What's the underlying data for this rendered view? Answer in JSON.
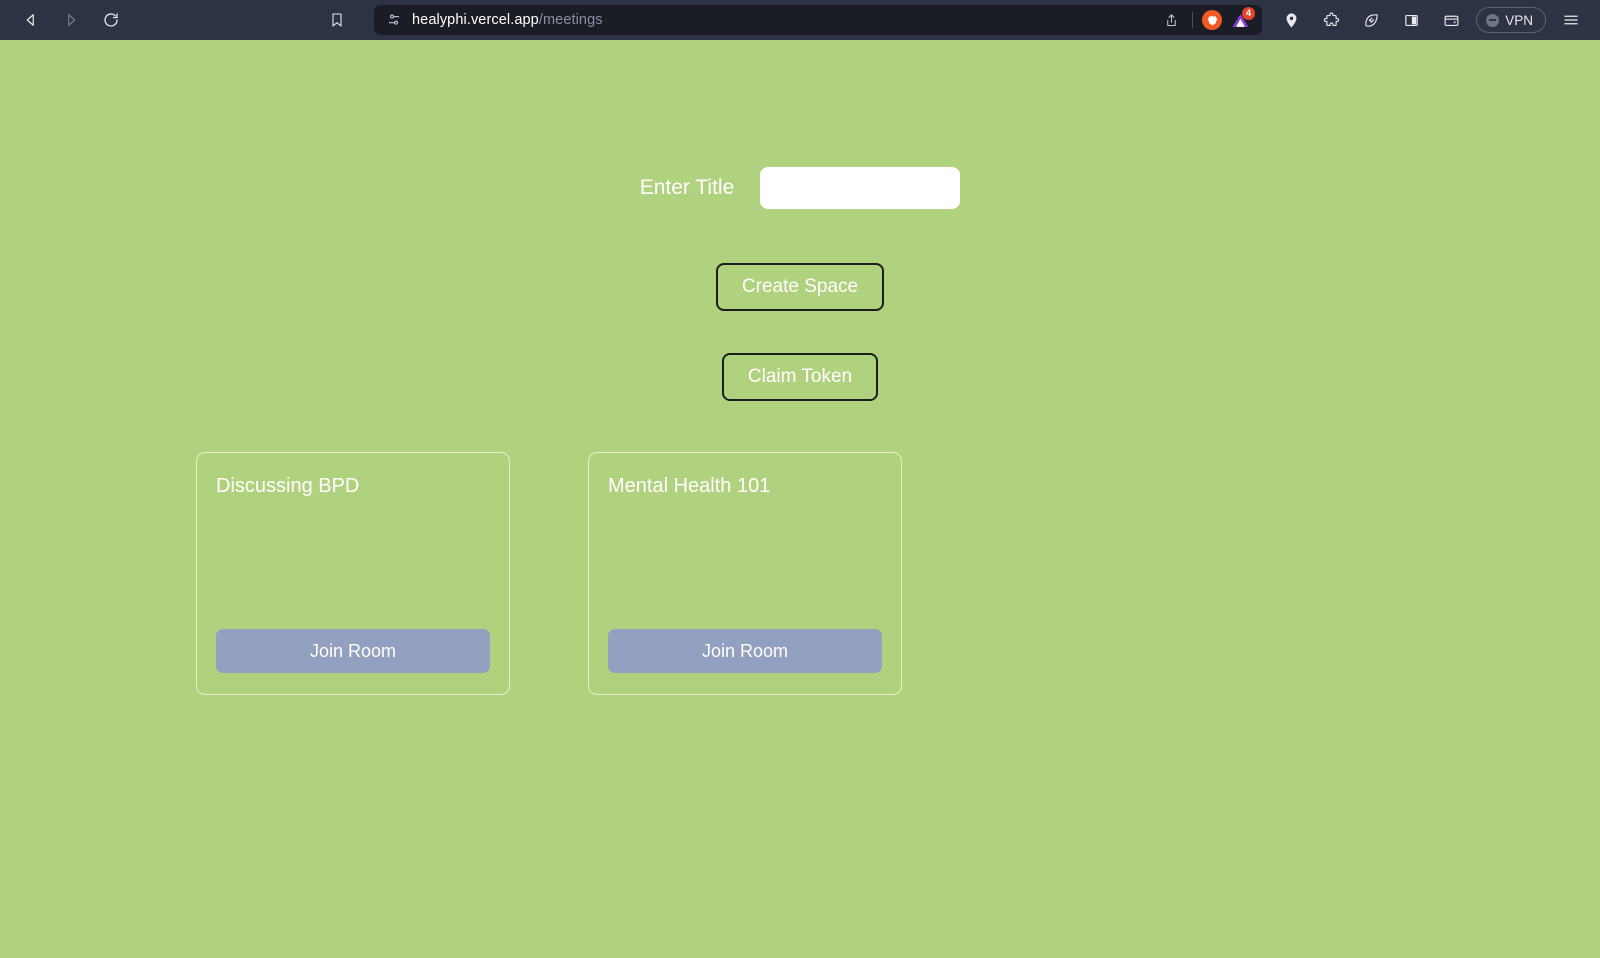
{
  "browser": {
    "nav": {
      "back": "back-arrow",
      "forward": "forward-arrow",
      "reload": "reload"
    },
    "bookmark_icon": "bookmark-icon",
    "url": {
      "domain": "healyphi.vercel.app",
      "path": "/meetings",
      "permission_icon": "site-settings-icon",
      "share_icon": "share-icon",
      "brave_shields_icon": "brave-lion-icon",
      "extension_icon": "vercel-extension-icon",
      "extension_badge": "4"
    },
    "right_icons": [
      {
        "name": "location-pin-icon",
        "label": "Location"
      },
      {
        "name": "puzzle-piece-icon",
        "label": "Extensions"
      },
      {
        "name": "brave-shields-leaf-icon",
        "label": "Shields"
      },
      {
        "name": "sidebar-panel-icon",
        "label": "Sidebar"
      },
      {
        "name": "wallet-icon",
        "label": "Wallet"
      }
    ],
    "vpn": {
      "label": "VPN"
    },
    "menu_icon": "hamburger-menu-icon"
  },
  "page": {
    "title_form": {
      "label": "Enter Title",
      "input_value": "",
      "input_placeholder": ""
    },
    "create_space_label": "Create Space",
    "claim_token_label": "Claim Token",
    "rooms": [
      {
        "title": "Discussing BPD",
        "join_label": "Join Room"
      },
      {
        "title": "Mental Health 101",
        "join_label": "Join Room"
      }
    ]
  },
  "colors": {
    "page_background": "#b0d27e",
    "toolbar_background": "#2e3344",
    "url_bar_background": "#1a1d26",
    "join_button": "#94a0c0",
    "card_border": "#e4f0d2",
    "button_border": "#1c1c1c",
    "badge": "#e8442c"
  }
}
